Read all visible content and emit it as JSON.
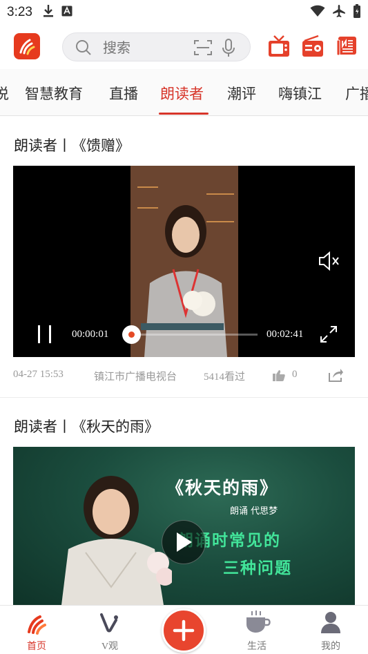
{
  "status_bar": {
    "time": "3:23"
  },
  "header": {
    "search_placeholder": "搜索"
  },
  "tabs": [
    {
      "label": "说"
    },
    {
      "label": "智慧教育"
    },
    {
      "label": "直播"
    },
    {
      "label": "朗读者",
      "active": true
    },
    {
      "label": "潮评"
    },
    {
      "label": "嗨镇江"
    },
    {
      "label": "广播"
    }
  ],
  "feed": [
    {
      "title": "朗读者丨《馈赠》",
      "player": {
        "current_time": "00:00:01",
        "total_time": "00:02:41",
        "progress": 0.01,
        "state": "playing",
        "muted": true
      },
      "date": "04-27 15:53",
      "source": "镇江市广播电视台",
      "views": "5414看过",
      "likes": "0"
    },
    {
      "title": "朗读者丨《秋天的雨》",
      "cover": {
        "title": "《秋天的雨》",
        "reciter": "朗诵  代思梦",
        "line1": "朗诵时常见的",
        "line2": "三种问题"
      }
    }
  ],
  "bottom_nav": [
    {
      "label": "首页",
      "icon": "home-logo-icon",
      "active": true
    },
    {
      "label": "V观",
      "icon": "v-icon"
    },
    {
      "label": "",
      "icon": "plus-icon"
    },
    {
      "label": "生活",
      "icon": "cup-icon"
    },
    {
      "label": "我的",
      "icon": "user-icon"
    }
  ],
  "colors": {
    "accent": "#d7352a",
    "fab": "#e8452e",
    "highlight_green": "#42e59a"
  }
}
